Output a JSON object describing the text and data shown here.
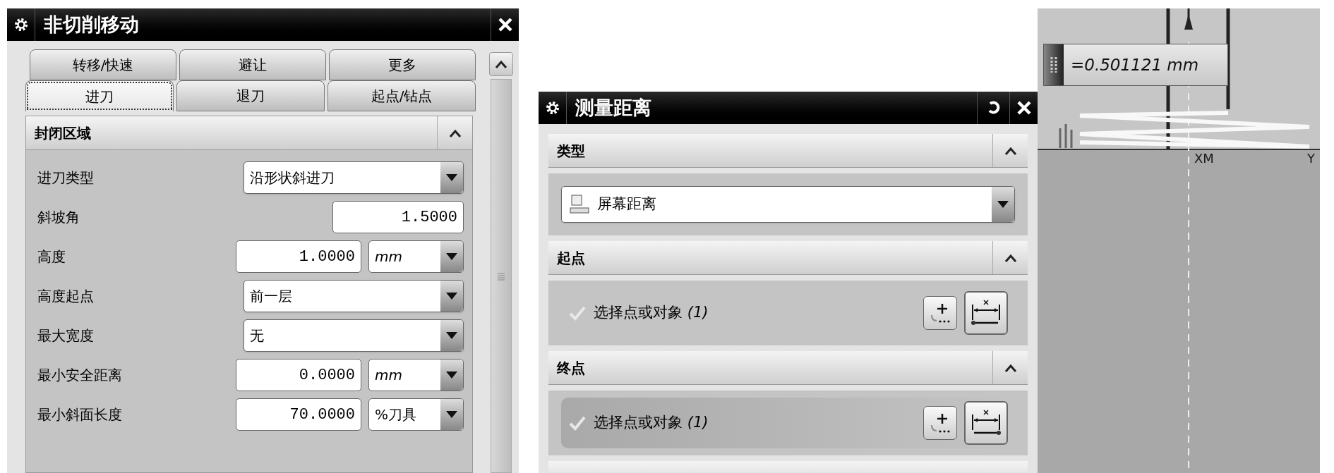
{
  "left_dialog": {
    "title": "非切削移动",
    "tab_rows": [
      [
        {
          "label": "转移/快速",
          "selected": false
        },
        {
          "label": "避让",
          "selected": false
        },
        {
          "label": "更多",
          "selected": false
        }
      ],
      [
        {
          "label": "进刀",
          "selected": true
        },
        {
          "label": "退刀",
          "selected": false
        },
        {
          "label": "起点/钻点",
          "selected": false
        }
      ]
    ],
    "section": {
      "title": "封闭区域",
      "expanded": true
    },
    "fields": [
      {
        "kind": "dropdown",
        "label": "进刀类型",
        "value": "沿形状斜进刀"
      },
      {
        "kind": "number",
        "label": "斜坡角",
        "value": "1.5000"
      },
      {
        "kind": "number_unit",
        "label": "高度",
        "value": "1.0000",
        "unit": "mm"
      },
      {
        "kind": "dropdown",
        "label": "高度起点",
        "value": "前一层"
      },
      {
        "kind": "dropdown",
        "label": "最大宽度",
        "value": "无"
      },
      {
        "kind": "number_unit",
        "label": "最小安全距离",
        "value": "0.0000",
        "unit": "mm"
      },
      {
        "kind": "number_unit",
        "label": "最小斜面长度",
        "value": "70.0000",
        "unit": "%刀具"
      }
    ]
  },
  "measure_dialog": {
    "title": "测量距离",
    "sections": [
      {
        "kind": "dropdown",
        "title": "类型",
        "expanded": true,
        "value": "屏幕距离"
      },
      {
        "kind": "selection",
        "title": "起点",
        "expanded": true,
        "prompt": "选择点或对象 *(1)*",
        "active": false
      },
      {
        "kind": "selection",
        "title": "终点",
        "expanded": true,
        "prompt": "选择点或对象 *(1)*",
        "active": true
      }
    ]
  },
  "viewport": {
    "measurement": "=0.501121 mm",
    "axis_labels": [
      "XM",
      "Y"
    ]
  }
}
